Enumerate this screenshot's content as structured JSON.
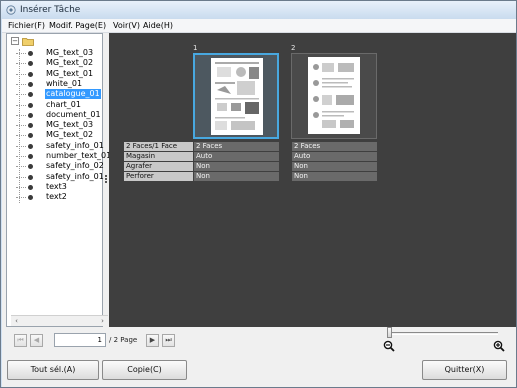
{
  "window": {
    "title": "Insérer Tâche"
  },
  "menu": [
    "Fichier(F)",
    "Modif. Page(E)",
    "Voir(V)",
    "Aide(H)"
  ],
  "tree": {
    "items": [
      "MG_text_03",
      "MG_text_02",
      "MG_text_01",
      "white_01",
      "catalogue_01",
      "chart_01",
      "document_01",
      "MG_text_03",
      "MG_text_02",
      "safety_info_01",
      "number_text_01",
      "safety_info_02",
      "safety_info_01",
      "text3",
      "text2"
    ],
    "selected_index": 4
  },
  "pages": [
    {
      "number": "1",
      "selected": true
    },
    {
      "number": "2",
      "selected": false
    }
  ],
  "properties": {
    "keys": [
      "2 Faces/1 Face",
      "Magasin",
      "Agrafer",
      "Perforer"
    ],
    "page1": [
      "2 Faces",
      "Auto",
      "Non",
      "Non"
    ],
    "page2": [
      "2 Faces",
      "Auto",
      "Non",
      "Non"
    ]
  },
  "navigation": {
    "current_page": "1",
    "total_label": "/ 2  Page",
    "zoom_level": 0.0
  },
  "buttons": {
    "select_all": "Tout sél.(A)",
    "copy": "Copie(C)",
    "quit": "Quitter(X)"
  },
  "colors": {
    "selected_item": "#3399ff",
    "selected_page_border": "#48a8e0",
    "preview_bg": "#3f3f3f"
  }
}
